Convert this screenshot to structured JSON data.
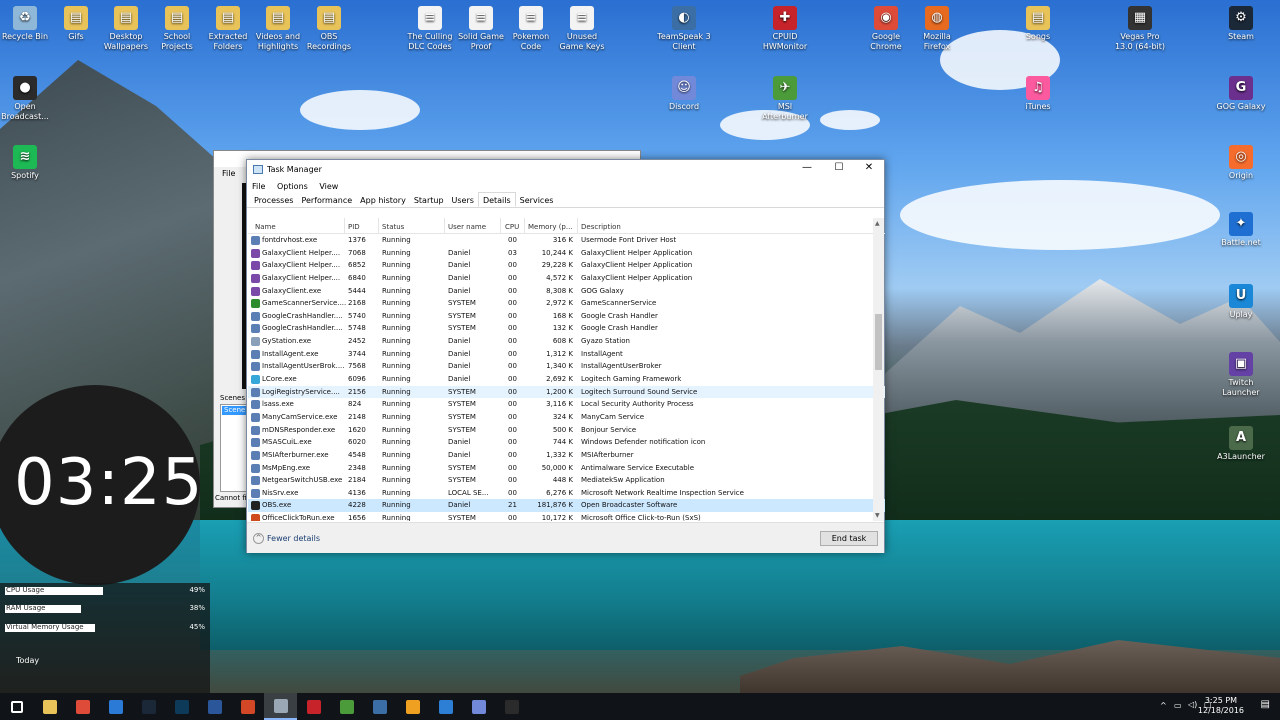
{
  "desktop": {
    "left_icons": [
      {
        "label": "Recycle Bin",
        "color": "#8fb7d8",
        "glyph": "♻"
      },
      {
        "label": "Gifs",
        "color": "#e8c35a",
        "glyph": "▤"
      },
      {
        "label": "Desktop Wallpapers",
        "color": "#e8c35a",
        "glyph": "▤"
      },
      {
        "label": "School Projects",
        "color": "#e8c35a",
        "glyph": "▤"
      },
      {
        "label": "Extracted Folders",
        "color": "#e8c35a",
        "glyph": "▤"
      },
      {
        "label": "Videos and Highlights",
        "color": "#e8c35a",
        "glyph": "▤"
      },
      {
        "label": "OBS Recordings",
        "color": "#e8c35a",
        "glyph": "▤"
      },
      {
        "label": "The Culling DLC Codes",
        "color": "#f3f3f3",
        "glyph": "≡"
      },
      {
        "label": "Solid Game Proof",
        "color": "#f3f3f3",
        "glyph": "≡"
      },
      {
        "label": "Pokemon Code",
        "color": "#f3f3f3",
        "glyph": "≡"
      },
      {
        "label": "Unused Game Keys",
        "color": "#f3f3f3",
        "glyph": "≡"
      }
    ],
    "column_icons": [
      {
        "label": "Open Broadcast...",
        "color": "#2b2b2b",
        "glyph": "●"
      },
      {
        "label": "Spotify",
        "color": "#1db954",
        "glyph": "≋"
      }
    ],
    "mid_icons": [
      {
        "label": "TeamSpeak 3 Client",
        "color": "#3a6ea5",
        "glyph": "◐"
      },
      {
        "label": "Discord",
        "color": "#7289da",
        "glyph": "☺"
      },
      {
        "label": "CPUID HWMonitor",
        "color": "#c6242a",
        "glyph": "✚"
      },
      {
        "label": "MSI Afterburner",
        "color": "#4b9b3a",
        "glyph": "✈"
      },
      {
        "label": "Google Chrome",
        "color": "#de4b39",
        "glyph": "◉"
      },
      {
        "label": "Mozilla Firefox",
        "color": "#e66a1f",
        "glyph": "◍"
      },
      {
        "label": "Songs",
        "color": "#e8c35a",
        "glyph": "▤"
      },
      {
        "label": "iTunes",
        "color": "#fb5a9e",
        "glyph": "♫"
      }
    ],
    "right_icons": [
      {
        "label": "Vegas Pro 13.0 (64-bit)",
        "color": "#333333",
        "glyph": "▦"
      },
      {
        "label": "Steam",
        "color": "#1b2838",
        "glyph": "⚙"
      },
      {
        "label": "GOG Galaxy",
        "color": "#6b2f8e",
        "glyph": "G"
      },
      {
        "label": "Origin",
        "color": "#f56c2d",
        "glyph": "◎"
      },
      {
        "label": "Battle.net",
        "color": "#1e6fd1",
        "glyph": "✦"
      },
      {
        "label": "Uplay",
        "color": "#1a87d7",
        "glyph": "U"
      },
      {
        "label": "Twitch Launcher",
        "color": "#6441a4",
        "glyph": "▣"
      },
      {
        "label": "A3Launcher",
        "color": "#4a6a4a",
        "glyph": "A"
      }
    ]
  },
  "widget": {
    "clock": "03:25",
    "meters": [
      {
        "label": "CPU Usage",
        "value": 49,
        "text": "49%"
      },
      {
        "label": "RAM Usage",
        "value": 38,
        "text": "38%"
      },
      {
        "label": "Virtual Memory Usage",
        "value": 45,
        "text": "45%"
      }
    ],
    "today": "Today"
  },
  "obs": {
    "menu": "File",
    "scenes_label": "Scenes",
    "scene_item": "Scene",
    "status": "Cannot fi"
  },
  "task_manager": {
    "title": "Task Manager",
    "menu": [
      "File",
      "Options",
      "View"
    ],
    "tabs": [
      "Processes",
      "Performance",
      "App history",
      "Startup",
      "Users",
      "Details",
      "Services"
    ],
    "active_tab": "Details",
    "columns": [
      "Name",
      "PID",
      "Status",
      "User name",
      "CPU",
      "Memory (p...",
      "Description"
    ],
    "rows": [
      {
        "name": "fontdrvhost.exe",
        "pid": "1376",
        "status": "Running",
        "user": "",
        "cpu": "00",
        "mem": "316 K",
        "desc": "Usermode Font Driver Host",
        "icon": "#5b7fb5"
      },
      {
        "name": "GalaxyClient Helper....",
        "pid": "7068",
        "status": "Running",
        "user": "Daniel",
        "cpu": "03",
        "mem": "10,244 K",
        "desc": "GalaxyClient Helper Application",
        "icon": "#7b4aa8"
      },
      {
        "name": "GalaxyClient Helper....",
        "pid": "6852",
        "status": "Running",
        "user": "Daniel",
        "cpu": "00",
        "mem": "29,228 K",
        "desc": "GalaxyClient Helper Application",
        "icon": "#7b4aa8"
      },
      {
        "name": "GalaxyClient Helper....",
        "pid": "6840",
        "status": "Running",
        "user": "Daniel",
        "cpu": "00",
        "mem": "4,572 K",
        "desc": "GalaxyClient Helper Application",
        "icon": "#7b4aa8"
      },
      {
        "name": "GalaxyClient.exe",
        "pid": "5444",
        "status": "Running",
        "user": "Daniel",
        "cpu": "00",
        "mem": "8,308 K",
        "desc": "GOG Galaxy",
        "icon": "#7b4aa8"
      },
      {
        "name": "GameScannerService....",
        "pid": "2168",
        "status": "Running",
        "user": "SYSTEM",
        "cpu": "00",
        "mem": "2,972 K",
        "desc": "GameScannerService",
        "icon": "#2e8b2e"
      },
      {
        "name": "GoogleCrashHandler....",
        "pid": "5740",
        "status": "Running",
        "user": "SYSTEM",
        "cpu": "00",
        "mem": "168 K",
        "desc": "Google Crash Handler",
        "icon": "#5b7fb5"
      },
      {
        "name": "GoogleCrashHandler....",
        "pid": "5748",
        "status": "Running",
        "user": "SYSTEM",
        "cpu": "00",
        "mem": "132 K",
        "desc": "Google Crash Handler",
        "icon": "#5b7fb5"
      },
      {
        "name": "GyStation.exe",
        "pid": "2452",
        "status": "Running",
        "user": "Daniel",
        "cpu": "00",
        "mem": "608 K",
        "desc": "Gyazo Station",
        "icon": "#8aa0b8"
      },
      {
        "name": "InstallAgent.exe",
        "pid": "3744",
        "status": "Running",
        "user": "Daniel",
        "cpu": "00",
        "mem": "1,312 K",
        "desc": "InstallAgent",
        "icon": "#5b7fb5"
      },
      {
        "name": "InstallAgentUserBrok....",
        "pid": "7568",
        "status": "Running",
        "user": "Daniel",
        "cpu": "00",
        "mem": "1,340 K",
        "desc": "InstallAgentUserBroker",
        "icon": "#5b7fb5"
      },
      {
        "name": "LCore.exe",
        "pid": "6096",
        "status": "Running",
        "user": "Daniel",
        "cpu": "00",
        "mem": "2,692 K",
        "desc": "Logitech Gaming Framework",
        "icon": "#35a7d9"
      },
      {
        "name": "LogiRegistryService....",
        "pid": "2156",
        "status": "Running",
        "user": "SYSTEM",
        "cpu": "00",
        "mem": "1,200 K",
        "desc": "Logitech Surround Sound Service",
        "icon": "#5b7fb5"
      },
      {
        "name": "lsass.exe",
        "pid": "824",
        "status": "Running",
        "user": "SYSTEM",
        "cpu": "00",
        "mem": "3,116 K",
        "desc": "Local Security Authority Process",
        "icon": "#5b7fb5"
      },
      {
        "name": "ManyCamService.exe",
        "pid": "2148",
        "status": "Running",
        "user": "SYSTEM",
        "cpu": "00",
        "mem": "324 K",
        "desc": "ManyCam Service",
        "icon": "#5b7fb5"
      },
      {
        "name": "mDNSResponder.exe",
        "pid": "1620",
        "status": "Running",
        "user": "SYSTEM",
        "cpu": "00",
        "mem": "500 K",
        "desc": "Bonjour Service",
        "icon": "#5b7fb5"
      },
      {
        "name": "MSASCuiL.exe",
        "pid": "6020",
        "status": "Running",
        "user": "Daniel",
        "cpu": "00",
        "mem": "744 K",
        "desc": "Windows Defender notification icon",
        "icon": "#5b7fb5"
      },
      {
        "name": "MSIAfterburner.exe",
        "pid": "4548",
        "status": "Running",
        "user": "Daniel",
        "cpu": "00",
        "mem": "1,332 K",
        "desc": "MSIAfterburner",
        "icon": "#5b7fb5"
      },
      {
        "name": "MsMpEng.exe",
        "pid": "2348",
        "status": "Running",
        "user": "SYSTEM",
        "cpu": "00",
        "mem": "50,000 K",
        "desc": "Antimalware Service Executable",
        "icon": "#5b7fb5"
      },
      {
        "name": "NetgearSwitchUSB.exe",
        "pid": "2184",
        "status": "Running",
        "user": "SYSTEM",
        "cpu": "00",
        "mem": "448 K",
        "desc": "MediatekSw Application",
        "icon": "#5b7fb5"
      },
      {
        "name": "NisSrv.exe",
        "pid": "4136",
        "status": "Running",
        "user": "LOCAL SE...",
        "cpu": "00",
        "mem": "6,276 K",
        "desc": "Microsoft Network Realtime Inspection Service",
        "icon": "#5b7fb5"
      },
      {
        "name": "OBS.exe",
        "pid": "4228",
        "status": "Running",
        "user": "Daniel",
        "cpu": "21",
        "mem": "181,876 K",
        "desc": "Open Broadcaster Software",
        "icon": "#222222"
      },
      {
        "name": "OfficeClickToRun.exe",
        "pid": "1656",
        "status": "Running",
        "user": "SYSTEM",
        "cpu": "00",
        "mem": "10,172 K",
        "desc": "Microsoft Office Click-to-Run (SxS)",
        "icon": "#d04a1f"
      }
    ],
    "fewer_details": "Fewer details",
    "end_task": "End task"
  },
  "taskbar": {
    "apps": [
      {
        "name": "start",
        "color": "#ffffff"
      },
      {
        "name": "file-explorer",
        "color": "#e8c35a"
      },
      {
        "name": "chrome",
        "color": "#de4b39"
      },
      {
        "name": "ie",
        "color": "#2b7bd6"
      },
      {
        "name": "steam",
        "color": "#1b2838"
      },
      {
        "name": "photoshop",
        "color": "#0e3a5a"
      },
      {
        "name": "word",
        "color": "#2b579a"
      },
      {
        "name": "powerpoint",
        "color": "#d24726"
      },
      {
        "name": "task-manager",
        "color": "#9aa7b4"
      },
      {
        "name": "hwmonitor",
        "color": "#c6242a"
      },
      {
        "name": "xbox",
        "color": "#4b9b3a"
      },
      {
        "name": "teamspeak",
        "color": "#3a6ea5"
      },
      {
        "name": "chrome-canary",
        "color": "#f0a020"
      },
      {
        "name": "gyazo",
        "color": "#2d7fd6"
      },
      {
        "name": "discord",
        "color": "#7289da"
      },
      {
        "name": "obs",
        "color": "#2b2b2b"
      }
    ],
    "time": "3:25 PM",
    "date": "12/18/2016"
  }
}
